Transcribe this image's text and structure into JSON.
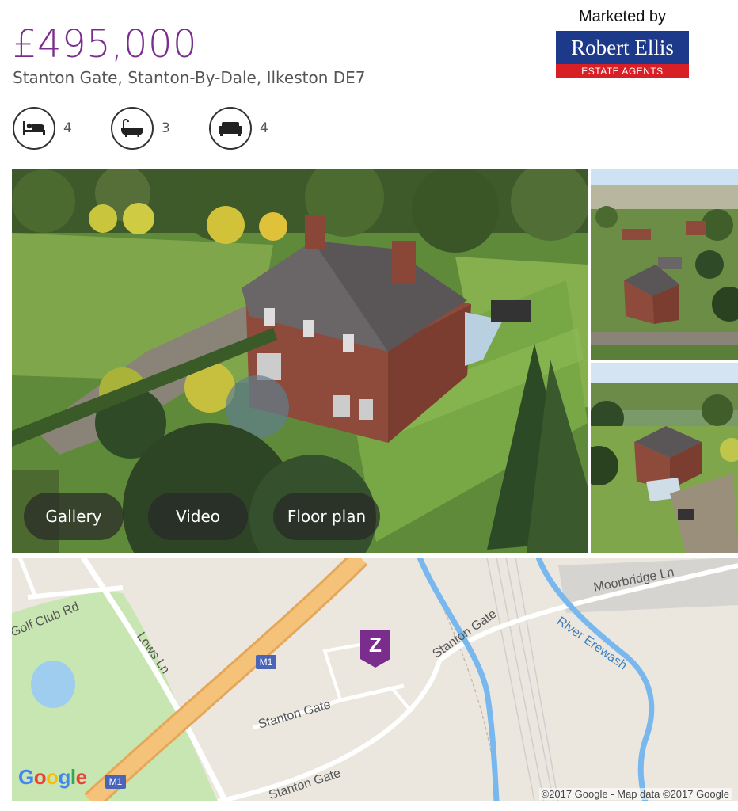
{
  "listing": {
    "price": "£495,000",
    "address": "Stanton Gate, Stanton-By-Dale, Ilkeston DE7"
  },
  "agent": {
    "label": "Marketed by",
    "logo_name": "Robert Ellis",
    "logo_subtitle": "ESTATE AGENTS"
  },
  "features": [
    {
      "icon": "bed-icon",
      "count": "4"
    },
    {
      "icon": "bath-icon",
      "count": "3"
    },
    {
      "icon": "sofa-icon",
      "count": "4"
    }
  ],
  "media_buttons": {
    "gallery": "Gallery",
    "video": "Video",
    "floor_plan": "Floor plan"
  },
  "map": {
    "labels": {
      "golf_club": "Golf Club Rd",
      "lows": "Lows Ln",
      "moorbridge": "Moorbridge Ln",
      "stanton_gate_upper": "Stanton Gate",
      "stanton_gate_mid": "Stanton Gate",
      "stanton_gate_lower": "Stanton Gate",
      "river": "River Erewash",
      "m1_upper": "M1",
      "m1_lower": "M1"
    },
    "marker_letter": "Z",
    "google_logo": "Google",
    "copyright": "©2017 Google - Map data ©2017 Google"
  },
  "colors": {
    "accent": "#7b2d8e",
    "agent_blue": "#1d3a8a",
    "agent_red": "#d81f26",
    "motorway": "#f5b860",
    "river": "#78b8ee",
    "park": "#c8e6b2"
  }
}
